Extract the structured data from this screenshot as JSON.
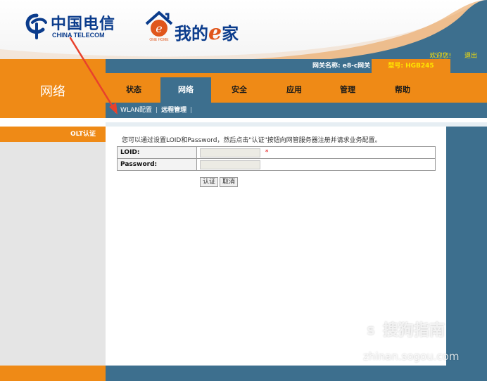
{
  "header": {
    "logo_cn": "中国电信",
    "logo_en": "CHINA TELECOM",
    "brand_badge": "ONE HOME",
    "brand_prefix": "我的",
    "brand_e": "e",
    "brand_suffix": "家",
    "welcome": "欢迎您!",
    "logout": "退出"
  },
  "info": {
    "gateway_name": "网关名称: e8-c网关",
    "model": "型号: HGB245"
  },
  "section_title": "网络",
  "tabs": [
    {
      "label": "状态",
      "active": false
    },
    {
      "label": "网络",
      "active": true
    },
    {
      "label": "安全",
      "active": false
    },
    {
      "label": "应用",
      "active": false
    },
    {
      "label": "管理",
      "active": false
    },
    {
      "label": "帮助",
      "active": false
    }
  ],
  "subnav": {
    "sep": "|",
    "items": [
      "WLAN配置",
      "远程管理"
    ]
  },
  "sidebar": {
    "items": [
      "OLT认证"
    ]
  },
  "form": {
    "intro": "您可以通过设置LOID和Password，然后点击\"认证\"按钮向网管服务器注册并请求业务配置。",
    "loid_label": "LOID:",
    "password_label": "Password:",
    "required_mark": "*",
    "submit_label": "认证",
    "cancel_label": "取消"
  },
  "watermark": {
    "icon": "S",
    "cn": "搜狗指南",
    "en": "zhinan.sogou.com"
  },
  "colors": {
    "orange": "#ef8a16",
    "steel_blue": "#3d6f8e",
    "telecom_blue": "#0b3c8c",
    "annotation_red": "#e8412c"
  }
}
